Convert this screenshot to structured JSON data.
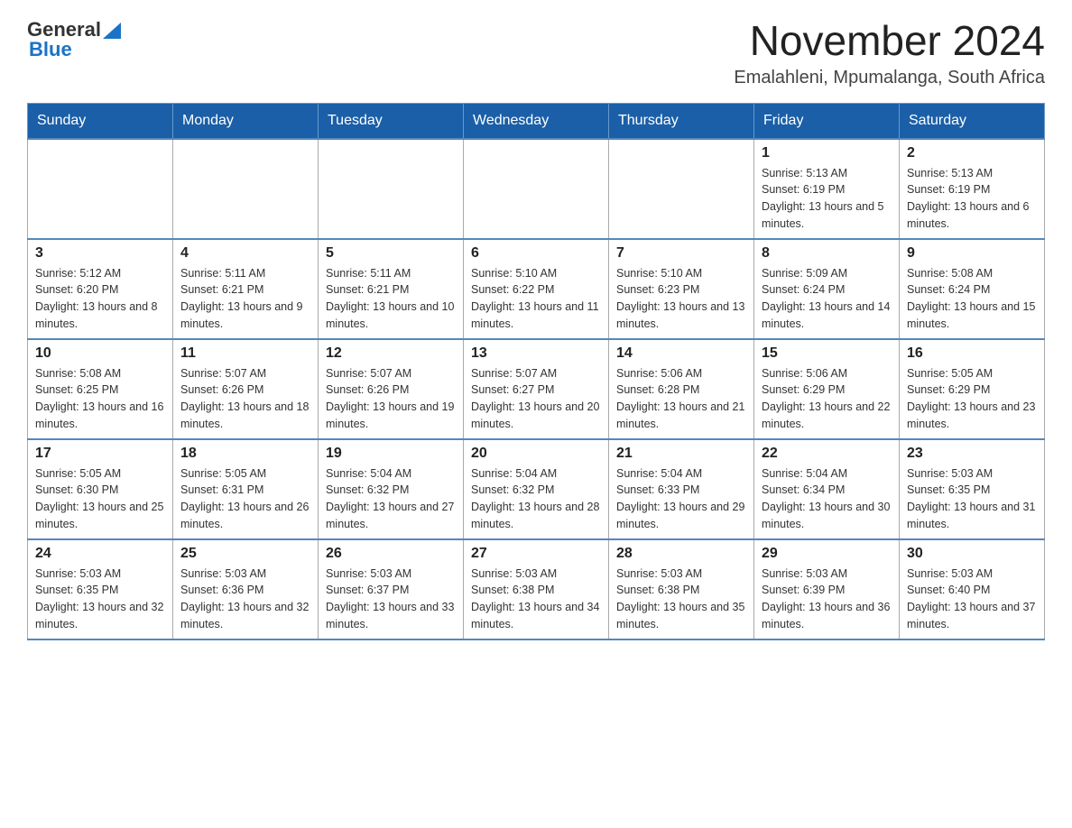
{
  "header": {
    "logo": {
      "general": "General",
      "blue": "Blue"
    },
    "month_title": "November 2024",
    "location": "Emalahleni, Mpumalanga, South Africa"
  },
  "weekdays": [
    "Sunday",
    "Monday",
    "Tuesday",
    "Wednesday",
    "Thursday",
    "Friday",
    "Saturday"
  ],
  "weeks": [
    [
      {
        "day": "",
        "info": ""
      },
      {
        "day": "",
        "info": ""
      },
      {
        "day": "",
        "info": ""
      },
      {
        "day": "",
        "info": ""
      },
      {
        "day": "",
        "info": ""
      },
      {
        "day": "1",
        "info": "Sunrise: 5:13 AM\nSunset: 6:19 PM\nDaylight: 13 hours and 5 minutes."
      },
      {
        "day": "2",
        "info": "Sunrise: 5:13 AM\nSunset: 6:19 PM\nDaylight: 13 hours and 6 minutes."
      }
    ],
    [
      {
        "day": "3",
        "info": "Sunrise: 5:12 AM\nSunset: 6:20 PM\nDaylight: 13 hours and 8 minutes."
      },
      {
        "day": "4",
        "info": "Sunrise: 5:11 AM\nSunset: 6:21 PM\nDaylight: 13 hours and 9 minutes."
      },
      {
        "day": "5",
        "info": "Sunrise: 5:11 AM\nSunset: 6:21 PM\nDaylight: 13 hours and 10 minutes."
      },
      {
        "day": "6",
        "info": "Sunrise: 5:10 AM\nSunset: 6:22 PM\nDaylight: 13 hours and 11 minutes."
      },
      {
        "day": "7",
        "info": "Sunrise: 5:10 AM\nSunset: 6:23 PM\nDaylight: 13 hours and 13 minutes."
      },
      {
        "day": "8",
        "info": "Sunrise: 5:09 AM\nSunset: 6:24 PM\nDaylight: 13 hours and 14 minutes."
      },
      {
        "day": "9",
        "info": "Sunrise: 5:08 AM\nSunset: 6:24 PM\nDaylight: 13 hours and 15 minutes."
      }
    ],
    [
      {
        "day": "10",
        "info": "Sunrise: 5:08 AM\nSunset: 6:25 PM\nDaylight: 13 hours and 16 minutes."
      },
      {
        "day": "11",
        "info": "Sunrise: 5:07 AM\nSunset: 6:26 PM\nDaylight: 13 hours and 18 minutes."
      },
      {
        "day": "12",
        "info": "Sunrise: 5:07 AM\nSunset: 6:26 PM\nDaylight: 13 hours and 19 minutes."
      },
      {
        "day": "13",
        "info": "Sunrise: 5:07 AM\nSunset: 6:27 PM\nDaylight: 13 hours and 20 minutes."
      },
      {
        "day": "14",
        "info": "Sunrise: 5:06 AM\nSunset: 6:28 PM\nDaylight: 13 hours and 21 minutes."
      },
      {
        "day": "15",
        "info": "Sunrise: 5:06 AM\nSunset: 6:29 PM\nDaylight: 13 hours and 22 minutes."
      },
      {
        "day": "16",
        "info": "Sunrise: 5:05 AM\nSunset: 6:29 PM\nDaylight: 13 hours and 23 minutes."
      }
    ],
    [
      {
        "day": "17",
        "info": "Sunrise: 5:05 AM\nSunset: 6:30 PM\nDaylight: 13 hours and 25 minutes."
      },
      {
        "day": "18",
        "info": "Sunrise: 5:05 AM\nSunset: 6:31 PM\nDaylight: 13 hours and 26 minutes."
      },
      {
        "day": "19",
        "info": "Sunrise: 5:04 AM\nSunset: 6:32 PM\nDaylight: 13 hours and 27 minutes."
      },
      {
        "day": "20",
        "info": "Sunrise: 5:04 AM\nSunset: 6:32 PM\nDaylight: 13 hours and 28 minutes."
      },
      {
        "day": "21",
        "info": "Sunrise: 5:04 AM\nSunset: 6:33 PM\nDaylight: 13 hours and 29 minutes."
      },
      {
        "day": "22",
        "info": "Sunrise: 5:04 AM\nSunset: 6:34 PM\nDaylight: 13 hours and 30 minutes."
      },
      {
        "day": "23",
        "info": "Sunrise: 5:03 AM\nSunset: 6:35 PM\nDaylight: 13 hours and 31 minutes."
      }
    ],
    [
      {
        "day": "24",
        "info": "Sunrise: 5:03 AM\nSunset: 6:35 PM\nDaylight: 13 hours and 32 minutes."
      },
      {
        "day": "25",
        "info": "Sunrise: 5:03 AM\nSunset: 6:36 PM\nDaylight: 13 hours and 32 minutes."
      },
      {
        "day": "26",
        "info": "Sunrise: 5:03 AM\nSunset: 6:37 PM\nDaylight: 13 hours and 33 minutes."
      },
      {
        "day": "27",
        "info": "Sunrise: 5:03 AM\nSunset: 6:38 PM\nDaylight: 13 hours and 34 minutes."
      },
      {
        "day": "28",
        "info": "Sunrise: 5:03 AM\nSunset: 6:38 PM\nDaylight: 13 hours and 35 minutes."
      },
      {
        "day": "29",
        "info": "Sunrise: 5:03 AM\nSunset: 6:39 PM\nDaylight: 13 hours and 36 minutes."
      },
      {
        "day": "30",
        "info": "Sunrise: 5:03 AM\nSunset: 6:40 PM\nDaylight: 13 hours and 37 minutes."
      }
    ]
  ]
}
